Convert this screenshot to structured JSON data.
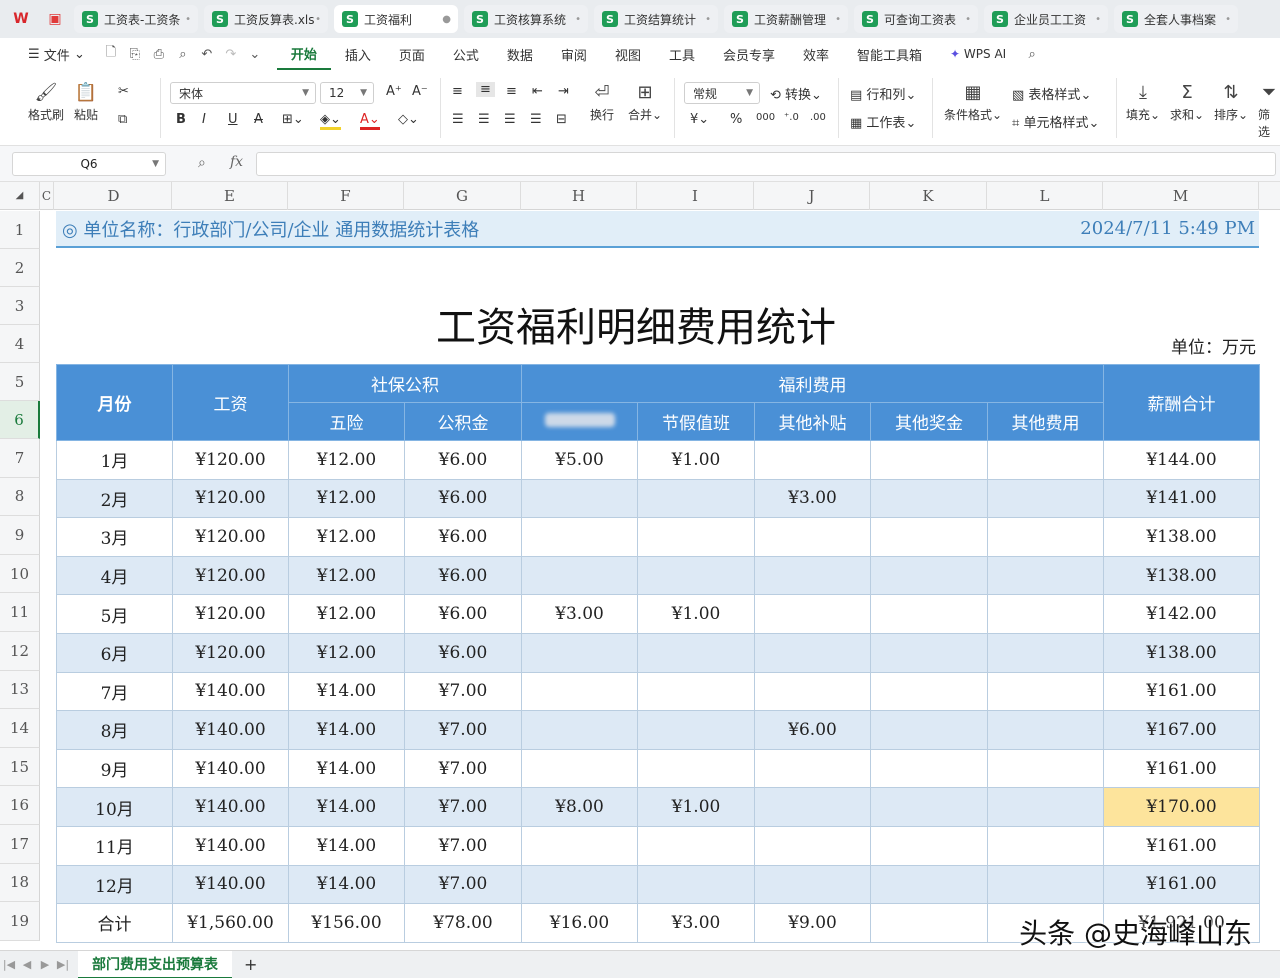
{
  "tabs": [
    {
      "label": "工资表-工资条",
      "active": false
    },
    {
      "label": "工资反算表.xls",
      "active": false
    },
    {
      "label": "工资福利",
      "active": true
    },
    {
      "label": "工资核算系统",
      "active": false
    },
    {
      "label": "工资结算统计",
      "active": false
    },
    {
      "label": "工资薪酬管理",
      "active": false
    },
    {
      "label": "可查询工资表",
      "active": false
    },
    {
      "label": "企业员工工资",
      "active": false
    },
    {
      "label": "全套人事档案",
      "active": false
    }
  ],
  "menu": {
    "file": "文件",
    "items": [
      "开始",
      "插入",
      "页面",
      "公式",
      "数据",
      "审阅",
      "视图",
      "工具",
      "会员专享",
      "效率",
      "智能工具箱"
    ],
    "active": "开始",
    "wps_ai": "WPS AI"
  },
  "ribbon": {
    "format_painter": "格式刷",
    "paste": "粘贴",
    "font_name": "宋体",
    "font_size": "12",
    "wrap": "换行",
    "merge": "合并",
    "number_format": "常规",
    "convert": "转换",
    "rows_cols": "行和列",
    "worksheet": "工作表",
    "cond_format": "条件格式",
    "table_style": "表格样式",
    "cell_style": "单元格样式",
    "fill": "填充",
    "sum": "求和",
    "sort": "排序",
    "filter": "筛选"
  },
  "formula_bar": {
    "cell": "Q6",
    "fx": "fx"
  },
  "columns": [
    "C",
    "D",
    "E",
    "F",
    "G",
    "H",
    "I",
    "J",
    "K",
    "L",
    "M"
  ],
  "rows": [
    "1",
    "2",
    "3",
    "4",
    "5",
    "6",
    "7",
    "8",
    "9",
    "10",
    "11",
    "12",
    "13",
    "14",
    "15",
    "16",
    "17",
    "18",
    "19"
  ],
  "sheet": {
    "unit_name": "◎ 单位名称：行政部门/公司/企业 通用数据统计表格",
    "datetime": "2024/7/11 5:49 PM",
    "title": "工资福利明细费用统计",
    "unit": "单位：万元",
    "header": {
      "month": "月份",
      "salary": "工资",
      "social": "社保公积",
      "welfare": "福利费用",
      "total": "薪酬合计",
      "insurance": "五险",
      "fund": "公积金",
      "holiday": "节假值班",
      "subsidy": "其他补贴",
      "bonus": "其他奖金",
      "other": "其他费用"
    },
    "data": [
      [
        "1月",
        "¥120.00",
        "¥12.00",
        "¥6.00",
        "¥5.00",
        "¥1.00",
        "",
        "",
        "",
        "¥144.00"
      ],
      [
        "2月",
        "¥120.00",
        "¥12.00",
        "¥6.00",
        "",
        "",
        "¥3.00",
        "",
        "",
        "¥141.00"
      ],
      [
        "3月",
        "¥120.00",
        "¥12.00",
        "¥6.00",
        "",
        "",
        "",
        "",
        "",
        "¥138.00"
      ],
      [
        "4月",
        "¥120.00",
        "¥12.00",
        "¥6.00",
        "",
        "",
        "",
        "",
        "",
        "¥138.00"
      ],
      [
        "5月",
        "¥120.00",
        "¥12.00",
        "¥6.00",
        "¥3.00",
        "¥1.00",
        "",
        "",
        "",
        "¥142.00"
      ],
      [
        "6月",
        "¥120.00",
        "¥12.00",
        "¥6.00",
        "",
        "",
        "",
        "",
        "",
        "¥138.00"
      ],
      [
        "7月",
        "¥140.00",
        "¥14.00",
        "¥7.00",
        "",
        "",
        "",
        "",
        "",
        "¥161.00"
      ],
      [
        "8月",
        "¥140.00",
        "¥14.00",
        "¥7.00",
        "",
        "",
        "¥6.00",
        "",
        "",
        "¥167.00"
      ],
      [
        "9月",
        "¥140.00",
        "¥14.00",
        "¥7.00",
        "",
        "",
        "",
        "",
        "",
        "¥161.00"
      ],
      [
        "10月",
        "¥140.00",
        "¥14.00",
        "¥7.00",
        "¥8.00",
        "¥1.00",
        "",
        "",
        "",
        "¥170.00"
      ],
      [
        "11月",
        "¥140.00",
        "¥14.00",
        "¥7.00",
        "",
        "",
        "",
        "",
        "",
        "¥161.00"
      ],
      [
        "12月",
        "¥140.00",
        "¥14.00",
        "¥7.00",
        "",
        "",
        "",
        "",
        "",
        "¥161.00"
      ],
      [
        "合计",
        "¥1,560.00",
        "¥156.00",
        "¥78.00",
        "¥16.00",
        "¥3.00",
        "¥9.00",
        "",
        "",
        "¥1,921.00"
      ]
    ]
  },
  "sheet_tab": "部门费用支出预算表",
  "watermark": "头条 @史海峰山东",
  "colors": {
    "header_blue": "#4a90d6",
    "alt_row": "#dde9f5",
    "highlight": "#fde49c",
    "accent_green": "#1a7a3c"
  }
}
